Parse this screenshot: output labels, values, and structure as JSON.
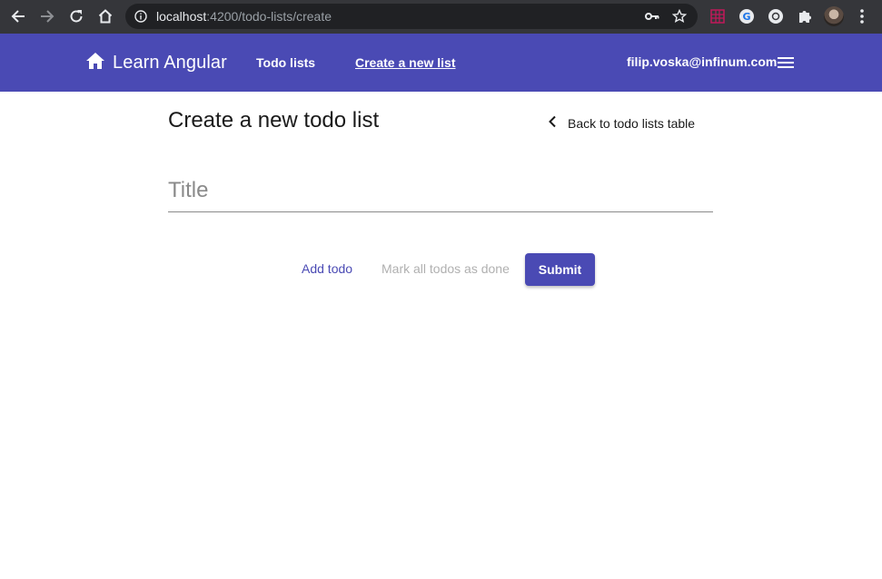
{
  "browser": {
    "url_host": "localhost",
    "url_path": ":4200/todo-lists/create",
    "icons": [
      "back-arrow-icon",
      "forward-arrow-icon",
      "reload-icon",
      "home-icon",
      "info-icon",
      "key-icon",
      "star-icon",
      "extension-grid-icon",
      "extension-g-icon",
      "extension-circle-icon",
      "puzzle-icon",
      "profile-avatar",
      "more-vert-icon"
    ]
  },
  "toolbar": {
    "brand": "Learn Angular",
    "nav": {
      "todo_lists": "Todo lists",
      "create_new_list": "Create a new list"
    },
    "user_email": "filip.voska@infinum.com",
    "accent_color": "#4a4ab4"
  },
  "main": {
    "page_title": "Create a new todo list",
    "back_link": "Back to todo lists table",
    "title_placeholder": "Title",
    "title_value": "",
    "actions": {
      "add_todo": "Add todo",
      "mark_all_done": "Mark all todos as done",
      "submit": "Submit"
    }
  }
}
